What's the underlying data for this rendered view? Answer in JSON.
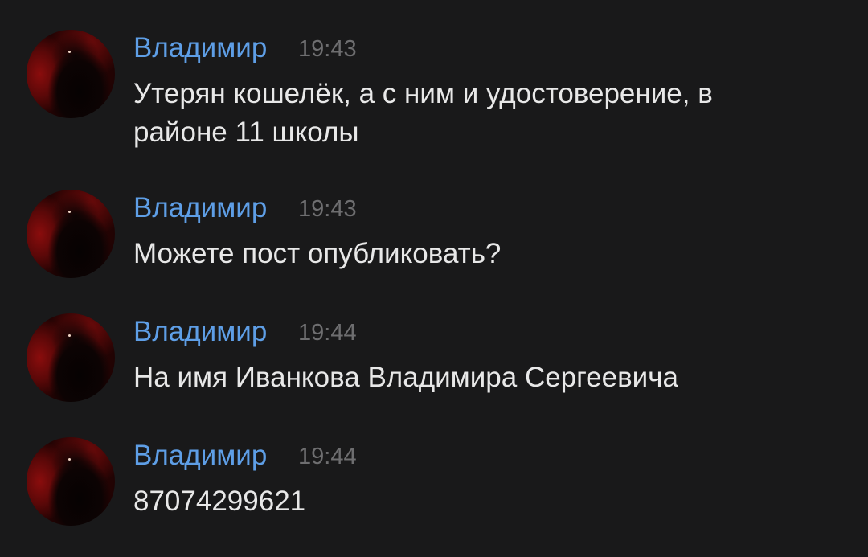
{
  "messages": [
    {
      "author": "Владимир",
      "time": "19:43",
      "text": "Утерян кошелёк, а с ним и удостоверение, в районе 11 школы"
    },
    {
      "author": "Владимир",
      "time": "19:43",
      "text": "Можете пост опубликовать?"
    },
    {
      "author": "Владимир",
      "time": "19:44",
      "text": "На имя Иванкова Владимира Сергеевича"
    },
    {
      "author": "Владимир",
      "time": "19:44",
      "text": "87074299621"
    }
  ]
}
